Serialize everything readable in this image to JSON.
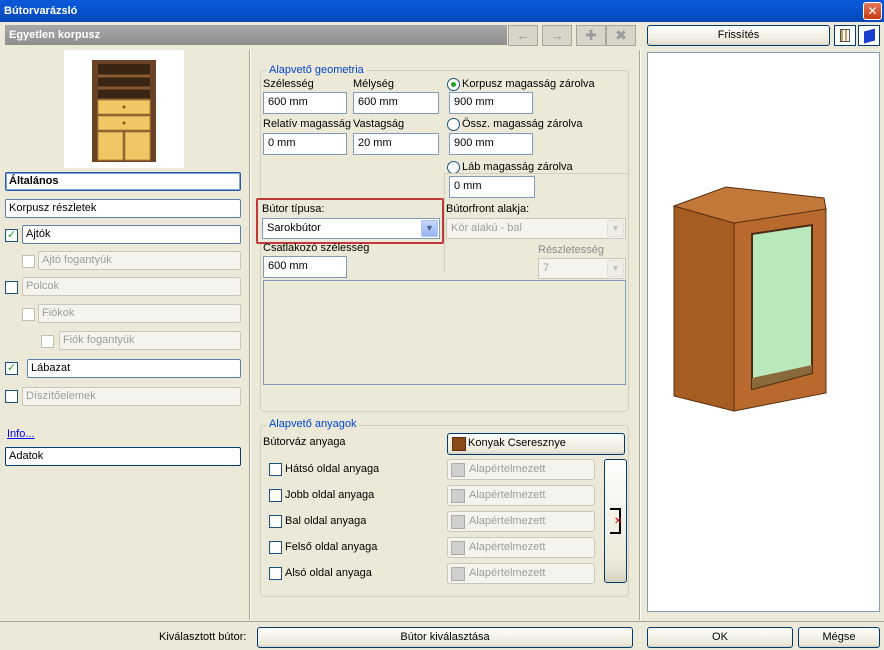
{
  "window": {
    "title": "Bútorvarázsló",
    "close_glyph": "✕"
  },
  "header": {
    "title": "Egyetlen korpusz",
    "nav_icons": [
      "arrow-left-icon",
      "arrow-right-icon",
      "plus-icon",
      "close-icon"
    ]
  },
  "refresh": {
    "label": "Frissítés"
  },
  "sidebar": {
    "items": [
      {
        "label": "Általános"
      },
      {
        "label": "Korpusz részletek"
      },
      {
        "label": "Ajtók"
      },
      {
        "label": "Ajtó fogantyúk"
      },
      {
        "label": "Polcok"
      },
      {
        "label": "Fiókok"
      },
      {
        "label": "Fiók fogantyúk"
      },
      {
        "label": "Lábazat"
      },
      {
        "label": "Díszítőelemek"
      }
    ],
    "info_link": "Info...",
    "data_button": "Adatok"
  },
  "geometry": {
    "title": "Alapvető geometria",
    "width_label": "Szélesség",
    "width_value": "600 mm",
    "depth_label": "Mélység",
    "depth_value": "600 mm",
    "relheight_label": "Relatív magasság",
    "relheight_value": "0 mm",
    "thickness_label": "Vastagság",
    "thickness_value": "20 mm",
    "radio_body_label": "Korpusz magasság zárolva",
    "radio_body_value": "900 mm",
    "radio_total_label": "Össz. magasság zárolva",
    "radio_total_value": "900 mm",
    "radio_leg_label": "Láb magasság zárolva",
    "radio_leg_value": "0 mm",
    "type_label": "Bútor típusa:",
    "type_value": "Sarokbútor",
    "front_label": "Bútorfront alakja:",
    "front_value": "Kör alakú - bal",
    "adjacent_label": "Csatlakozó szélesség",
    "adjacent_value": "600 mm",
    "detail_label": "Részletesség",
    "detail_value": "7"
  },
  "materials": {
    "title": "Alapvető anyagok",
    "frame_label": "Bútorváz anyaga",
    "frame_value": "Konyak Cseresznye",
    "rows": [
      {
        "label": "Hátsó oldal anyaga",
        "value": "Alapértelmezett"
      },
      {
        "label": "Jobb oldal anyaga",
        "value": "Alapértelmezett"
      },
      {
        "label": "Bal oldal anyaga",
        "value": "Alapértelmezett"
      },
      {
        "label": "Felső oldal anyaga",
        "value": "Alapértelmezett"
      },
      {
        "label": "Alsó oldal anyaga",
        "value": "Alapértelmezett"
      }
    ]
  },
  "footer": {
    "selected_label": "Kiválasztott bútor:",
    "select_button": "Bútor kiválasztása",
    "ok": "OK",
    "cancel": "Mégse"
  },
  "colors": {
    "titlebar": "#0654d0",
    "highlight": "#c0383c",
    "wood": "#b86a2e",
    "glass": "#b8e8bc"
  }
}
